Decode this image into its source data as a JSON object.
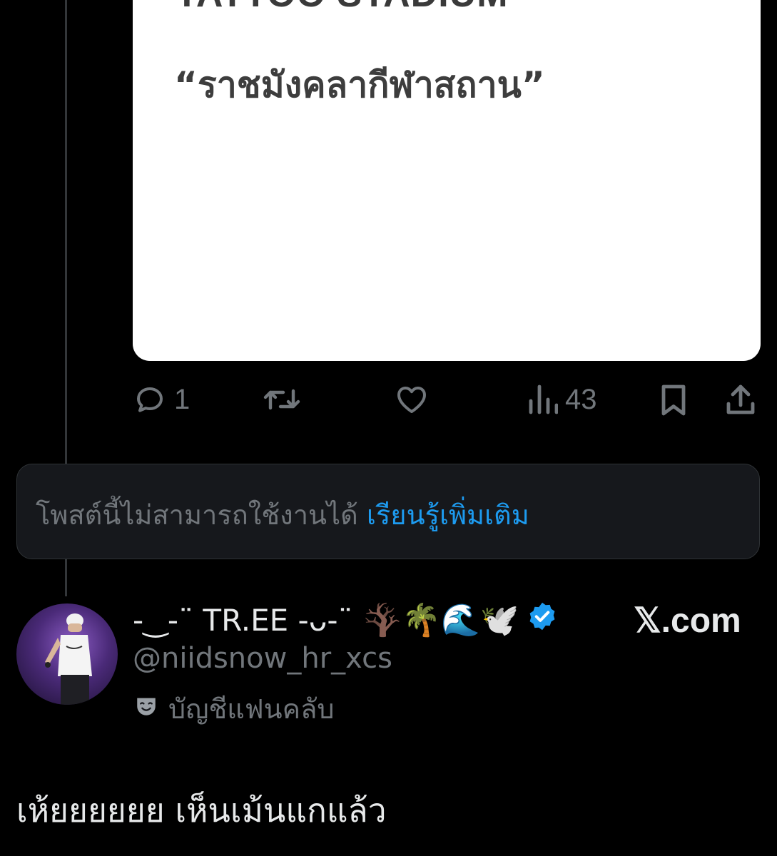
{
  "quoted_post": {
    "media_title": "TATTOO STADIUM",
    "media_subtitle": "“ราชมังคลากีฬาสถาน”",
    "actions": {
      "reply_count": "1",
      "repost_count": "",
      "like_count": "",
      "views_count": "43"
    }
  },
  "notice": {
    "text": "โพสต์นี้ไม่สามารถใช้งานได้",
    "link_label": "เรียนรู้เพิ่มเติม"
  },
  "author": {
    "display_name": "-‿-¨ TR.EE -ᴗ-¨",
    "name_emojis": "🪾🌴🌊🕊️",
    "handle": "@niidsnow_hr_xcs",
    "account_label": "บัญชีแฟนคลับ",
    "source": "𝕏.com"
  },
  "post": {
    "text": "เห้ยยยยยย เห็นเม้นแกแล้ว"
  },
  "colors": {
    "background": "#000000",
    "muted": "#71767b",
    "link": "#1d9bf0",
    "verified": "#1d9bf0"
  }
}
